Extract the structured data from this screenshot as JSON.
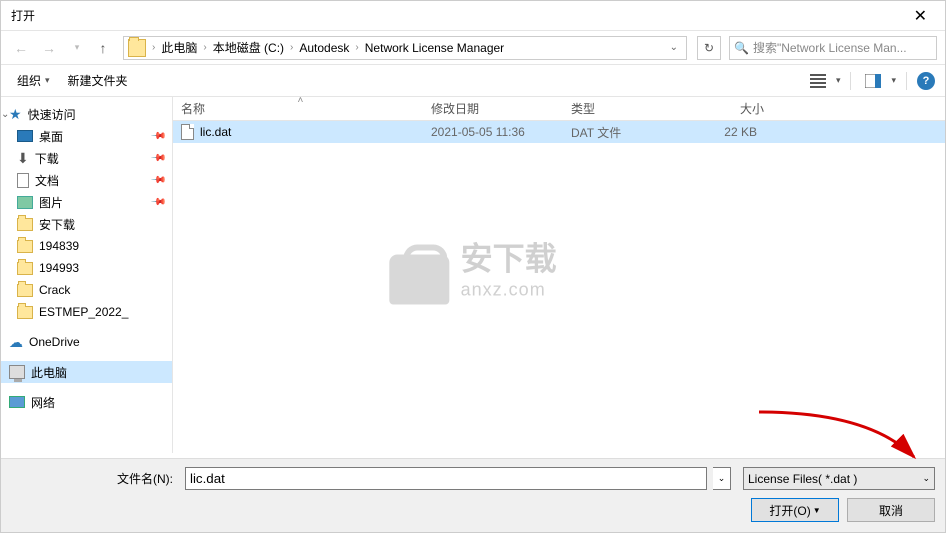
{
  "dialog_title": "打开",
  "breadcrumb": {
    "items": [
      "此电脑",
      "本地磁盘 (C:)",
      "Autodesk",
      "Network License Manager"
    ]
  },
  "search": {
    "placeholder": "搜索\"Network License Man..."
  },
  "toolbar": {
    "organize": "组织",
    "new_folder": "新建文件夹"
  },
  "sidebar": {
    "quick_access": "快速访问",
    "desktop": "桌面",
    "downloads": "下载",
    "documents": "文档",
    "pictures": "图片",
    "items": [
      "安下载",
      "194839",
      "194993",
      "Crack",
      "ESTMEP_2022_"
    ],
    "onedrive": "OneDrive",
    "this_pc": "此电脑",
    "network": "网络"
  },
  "columns": {
    "name": "名称",
    "date": "修改日期",
    "type": "类型",
    "size": "大小"
  },
  "files": [
    {
      "name": "lic.dat",
      "date": "2021-05-05 11:36",
      "type": "DAT 文件",
      "size": "22 KB"
    }
  ],
  "footer": {
    "filename_label": "文件名(N):",
    "filename_value": "lic.dat",
    "filter": "License Files( *.dat )",
    "open": "打开(O)",
    "cancel": "取消"
  },
  "watermark": {
    "cn": "安下载",
    "en": "anxz.com"
  }
}
